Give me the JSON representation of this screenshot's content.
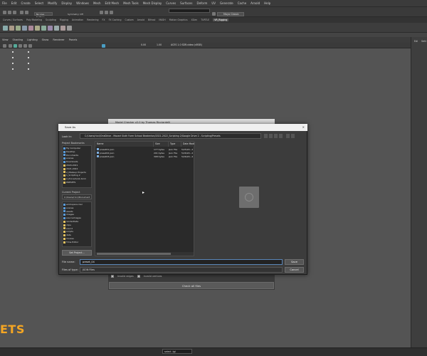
{
  "app": {
    "menus": [
      "File",
      "Edit",
      "Create",
      "Select",
      "Modify",
      "Display",
      "Windows",
      "Mesh",
      "Edit Mesh",
      "Mesh Tools",
      "Mesh Display",
      "Curves",
      "Surfaces",
      "Deform",
      "UV",
      "Generate",
      "Cache",
      "Arnold",
      "Help"
    ],
    "surface_select": "No Live Surface",
    "symmetry_label": "Symmetry: Off",
    "workspace_select": "Maya Classic",
    "shelf_tabs": [
      "Curves / Surfaces",
      "Poly Modeling",
      "Sculpting",
      "Rigging",
      "Animation",
      "Rendering",
      "FX",
      "FX Caching",
      "Custom",
      "Arnold",
      "Bifrost",
      "MASH",
      "Motion Graphics",
      "XGen",
      "TURTLE",
      "VR_Rigging"
    ],
    "shelf_active": "VR_Rigging",
    "viewport_menus": [
      "View",
      "Shading",
      "Lighting",
      "Show",
      "Renderer",
      "Panels"
    ],
    "colorspace_label": "ACES 1.0 SDR-video (sRGB)",
    "zoom_a": "0.00",
    "zoom_b": "1.00",
    "right_labels": [
      "Edi",
      "Sett"
    ],
    "logo": "ETS",
    "status_field": "select -tgl"
  },
  "bg_dialog": {
    "title": "Model Checker v2.0 by Thomas Ricciardelli",
    "check_invalid_edges": "Invalid edges",
    "check_invalid_vertices": "Invalid vertices",
    "check_all_button": "Check all files"
  },
  "save_dialog": {
    "title": "Save As",
    "look_in_label": "Look in:",
    "look_in_path": "C:/Users/ricci/OneDrive - Mozart Sixth Form School Bradenton/2021-2022_Scripting 2/Google Drive 2 - Scripting/Presets",
    "project_bookmarks_label": "Project Bookmarks",
    "project_bookmarks": [
      "My Computer",
      "Desktop",
      "Documents",
      "scenes",
      "Downloads",
      "2020-2021",
      "2021-2022",
      "2_Makeup Projects",
      "1_Scripting 2",
      "2_Procedural Anim",
      "PRESETS"
    ],
    "current_project_label": "Current Project",
    "current_project_select": "C:/Users/ricci/Document",
    "current_project_items": [
      "workspace.mel",
      "scenes",
      "assets",
      "images",
      "sourceimages",
      "renderData",
      "clips",
      "sound",
      "scripts",
      "data",
      "movies",
      "Time Editor"
    ],
    "set_project_button": "Set Project...",
    "columns": [
      "Name",
      "Size",
      "Type",
      "Date Modified"
    ],
    "files": [
      {
        "name": "preset01.json",
        "size": "177 bytes",
        "type": "Json File",
        "date": "5/25/20...2"
      },
      {
        "name": "preset02.json",
        "size": "201 bytes",
        "type": "Json File",
        "date": "5/26/20...2"
      },
      {
        "name": "preset03.json",
        "size": "398 bytes",
        "type": "Json File",
        "date": "5/26/20...2"
      }
    ],
    "file_name_label": "File name:",
    "file_name_value": "preset_04",
    "files_of_type_label": "Files of type:",
    "files_of_type_value": "JSON Files",
    "save_button": "Save",
    "cancel_button": "Cancel"
  }
}
